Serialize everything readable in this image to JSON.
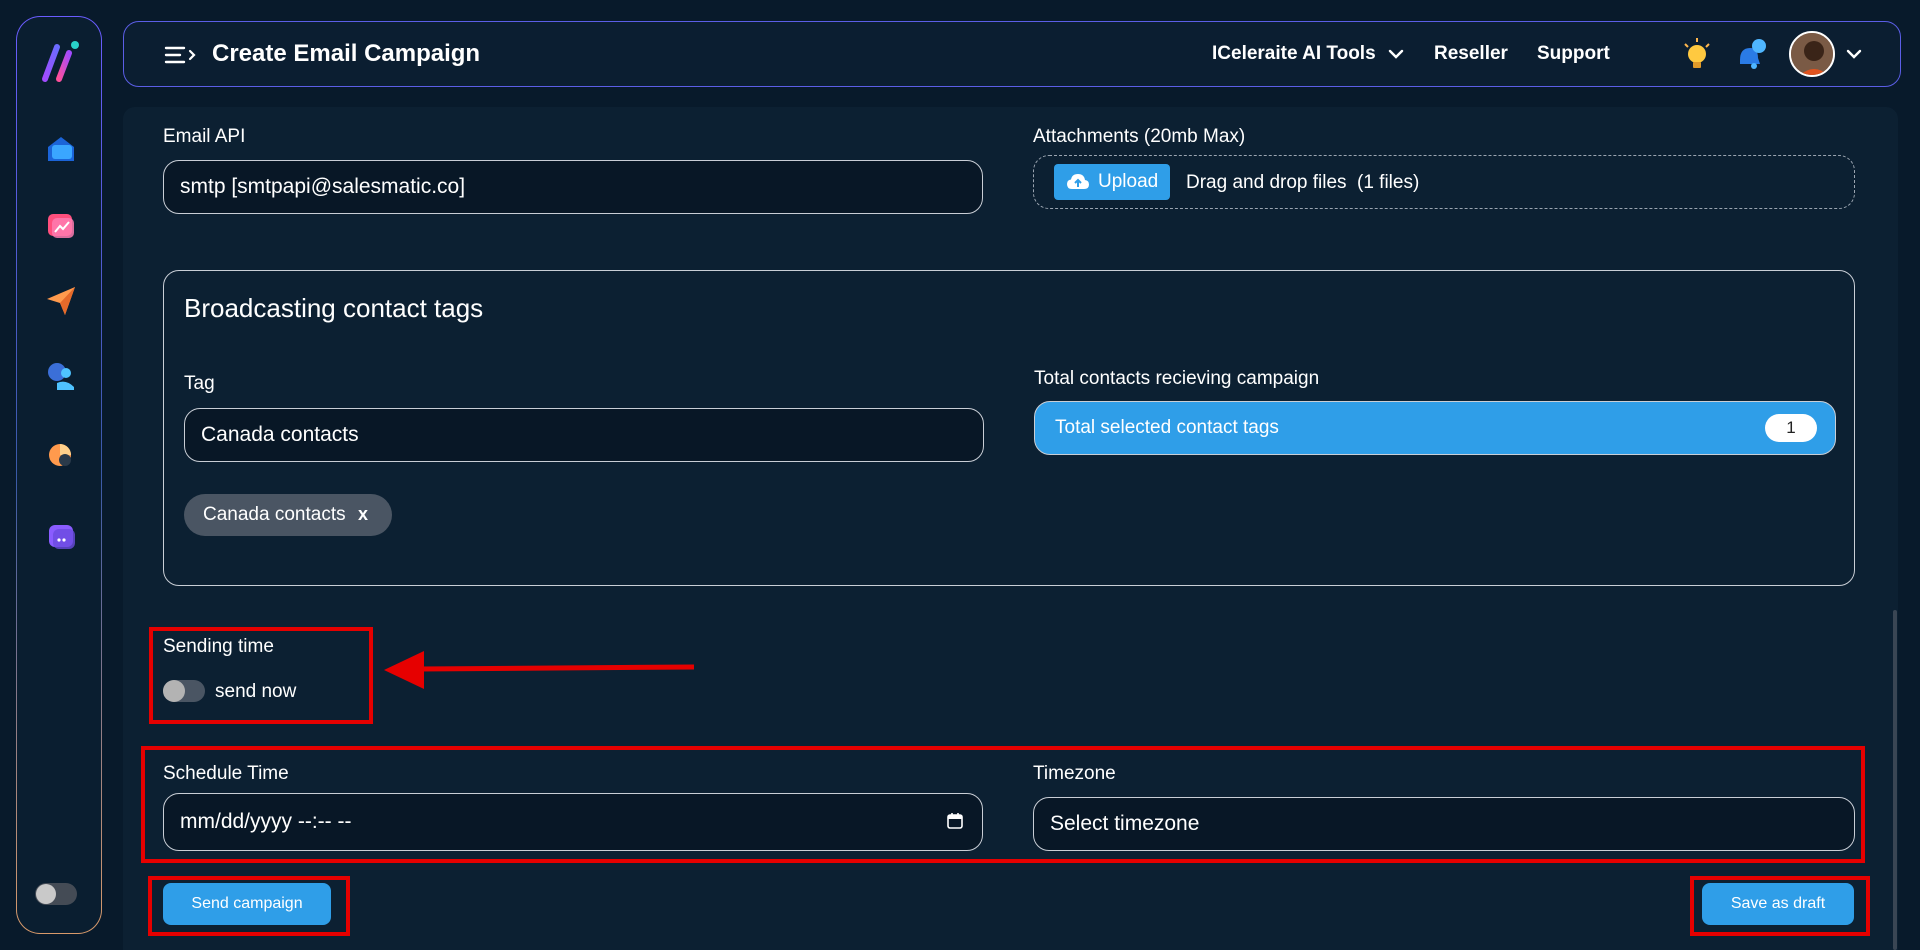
{
  "header": {
    "title": "Create Email Campaign",
    "nav": {
      "tools": "ICeleraite AI Tools",
      "reseller": "Reseller",
      "support": "Support"
    }
  },
  "email_api": {
    "label": "Email API",
    "value": "smtp [smtpapi@salesmatic.co]"
  },
  "attachments": {
    "label": "Attachments (20mb Max)",
    "upload_label": "Upload",
    "drop_text": "Drag and drop files",
    "count": "(1 files)"
  },
  "tags_card": {
    "title": "Broadcasting contact tags",
    "tag_label": "Tag",
    "tag_value": "Canada contacts",
    "total_label": "Total contacts recieving campaign",
    "total_bar_label": "Total selected contact tags",
    "total_count": "1",
    "chip_label": "Canada contacts",
    "chip_remove": "x"
  },
  "sending": {
    "label": "Sending time",
    "toggle_label": "send now"
  },
  "schedule": {
    "time_label": "Schedule Time",
    "time_placeholder": "mm/dd/yyyy --:-- --",
    "timezone_label": "Timezone",
    "timezone_placeholder": "Select timezone"
  },
  "actions": {
    "send": "Send campaign",
    "draft": "Save as draft"
  },
  "colors": {
    "background": "#081a2b",
    "accent": "#2f9ee8",
    "annotation": "#e60000"
  }
}
